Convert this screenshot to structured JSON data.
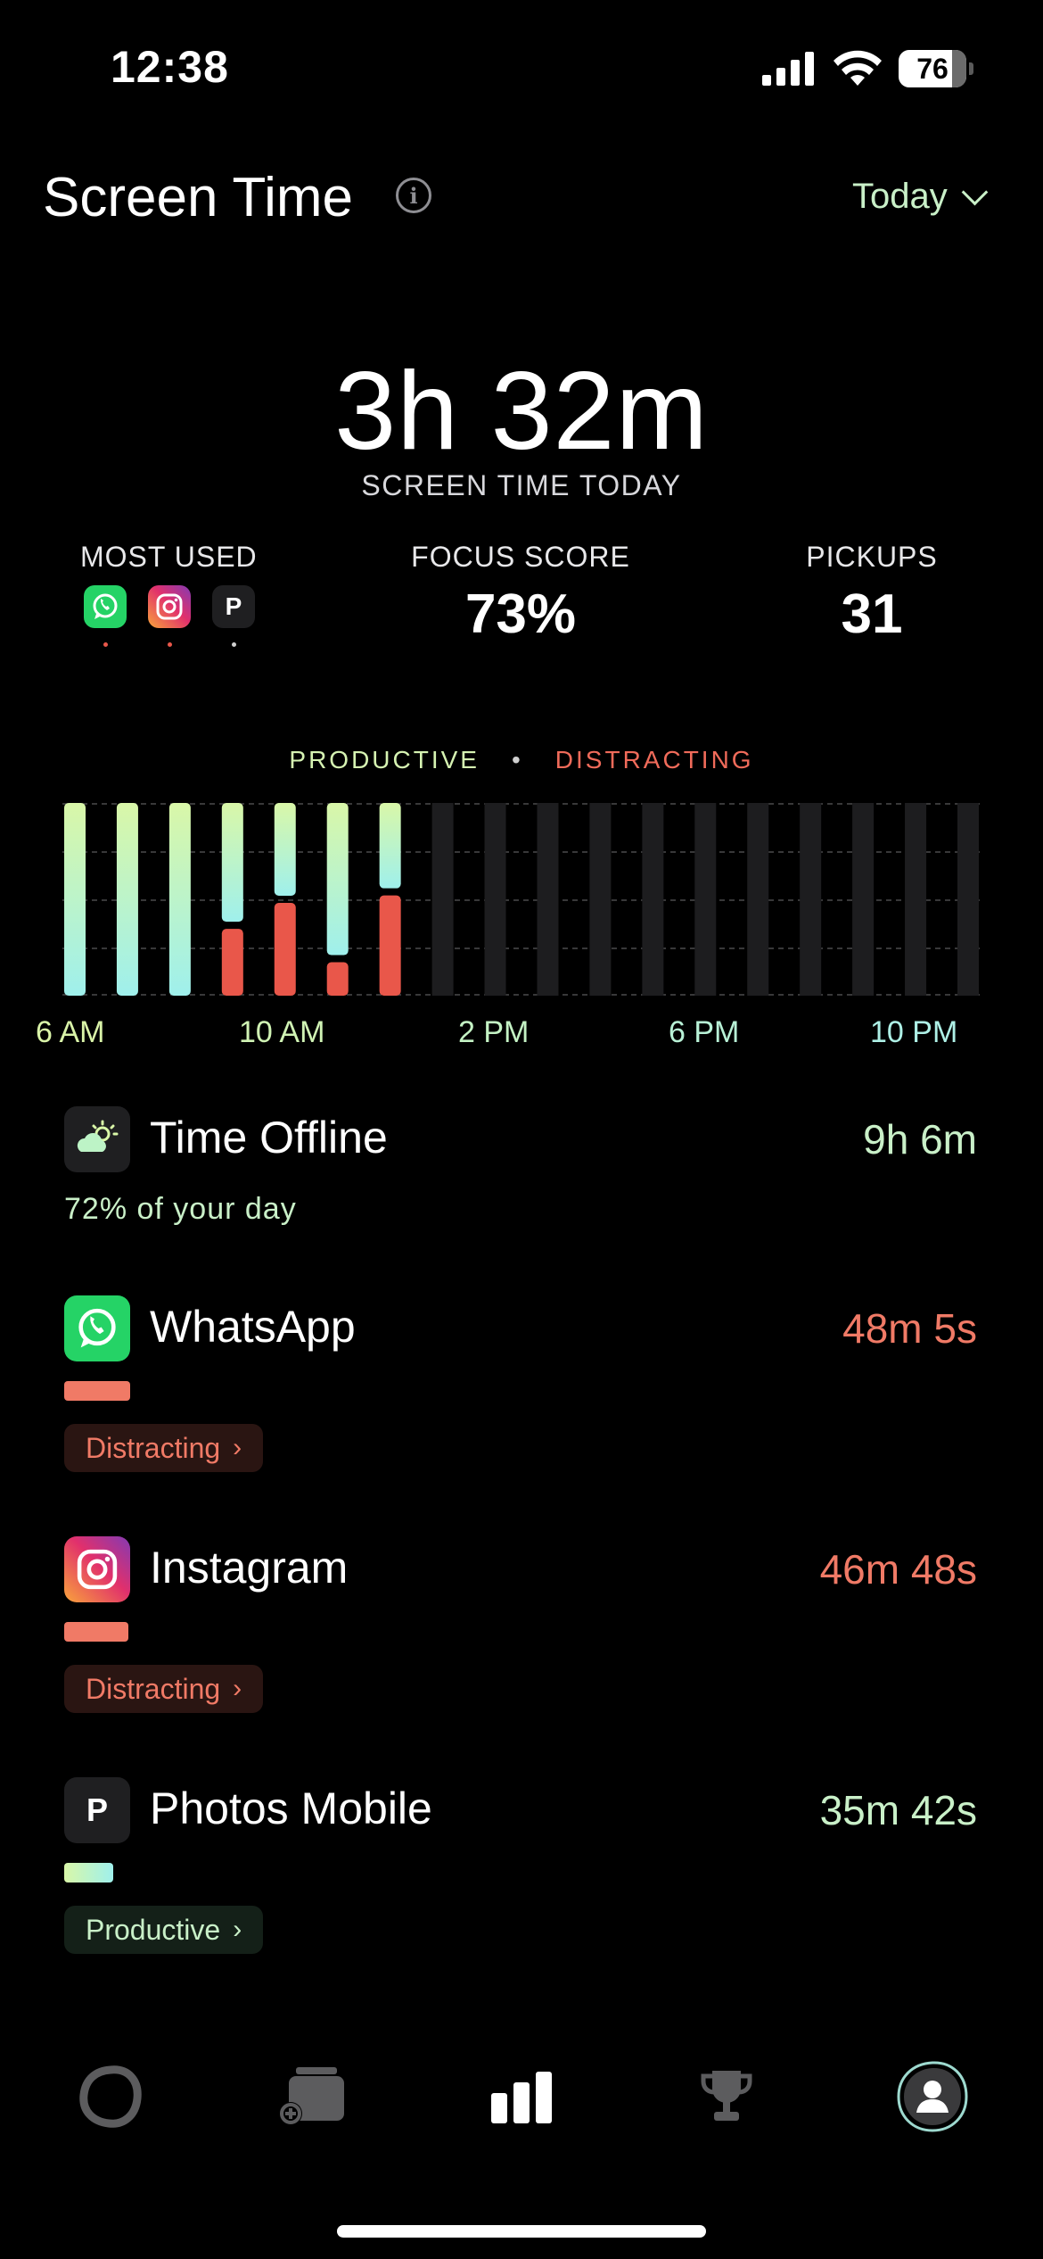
{
  "status_bar": {
    "time": "12:38",
    "battery": "76"
  },
  "header": {
    "title": "Screen Time",
    "range_label": "Today"
  },
  "summary": {
    "total_time": "3h 32m",
    "total_caption": "SCREEN TIME TODAY",
    "most_used_label": "MOST USED",
    "most_used_apps": [
      "whatsapp-icon",
      "instagram-icon",
      "photos-mobile-icon"
    ],
    "focus_label": "FOCUS SCORE",
    "focus_value": "73%",
    "pickups_label": "PICKUPS",
    "pickups_value": "31"
  },
  "colors": {
    "productive": "#cff7b0",
    "productive_gradient_end": "#9ff0ec",
    "distracting": "#e9574a",
    "inactive_bar": "#1d1d1f",
    "accent_text": "#c9f0c8"
  },
  "chart_legend": {
    "productive": "PRODUCTIVE",
    "distracting": "DISTRACTING"
  },
  "chart_axis_labels": [
    "6 AM",
    "10 AM",
    "2 PM",
    "6 PM",
    "10 PM"
  ],
  "chart_data": {
    "type": "bar",
    "x_ticks": [
      "6 AM",
      "10 AM",
      "2 PM",
      "6 PM",
      "10 PM"
    ],
    "categories": [
      "6 AM",
      "7 AM",
      "8 AM",
      "9 AM",
      "10 AM",
      "11 AM",
      "12 PM",
      "1 PM",
      "2 PM",
      "3 PM",
      "4 PM",
      "5 PM",
      "6 PM",
      "7 PM",
      "8 PM",
      "9 PM",
      "10 PM",
      "11 PM"
    ],
    "series": [
      {
        "name": "PRODUCTIVE",
        "values": [
          1.0,
          1.0,
          1.0,
          0.64,
          0.5,
          0.82,
          0.46,
          0,
          0,
          0,
          0,
          0,
          0,
          0,
          0,
          0,
          0,
          0
        ]
      },
      {
        "name": "DISTRACTING",
        "values": [
          0,
          0,
          0,
          0.36,
          0.5,
          0.18,
          0.54,
          0,
          0,
          0,
          0,
          0,
          0,
          0,
          0,
          0,
          0,
          0
        ]
      }
    ],
    "stacked": true,
    "ylim": [
      0,
      1
    ],
    "grid": true
  },
  "offline": {
    "title": "Time Offline",
    "time": "9h 6m",
    "caption": "72% of your day"
  },
  "apps": [
    {
      "name": "WhatsApp",
      "time": "48m 5s",
      "category": "Distracting",
      "bar_fraction": 1.0
    },
    {
      "name": "Instagram",
      "time": "46m 48s",
      "category": "Distracting",
      "bar_fraction": 0.97
    },
    {
      "name": "Photos Mobile",
      "time": "35m 42s",
      "category": "Productive",
      "bar_fraction": 0.74
    }
  ],
  "tabbar": {
    "items": [
      "home-icon",
      "add-photos-icon",
      "stats-icon",
      "trophy-icon",
      "profile-icon"
    ],
    "active": "stats-icon"
  }
}
